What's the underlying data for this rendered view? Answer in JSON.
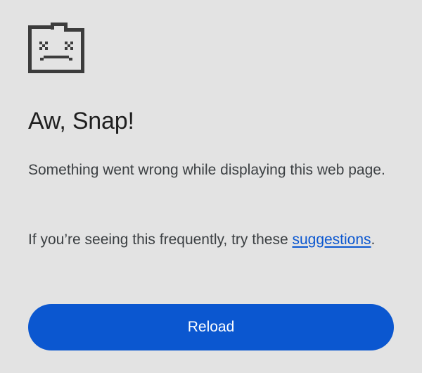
{
  "error": {
    "icon": "sad-tab-icon",
    "title": "Aw, Snap!",
    "description": "Something went wrong while displaying this web page.",
    "frequent_prefix": "If you’re seeing this frequently, try these ",
    "suggestions_link": "suggestions",
    "frequent_suffix": "."
  },
  "actions": {
    "reload_label": "Reload"
  },
  "colors": {
    "background": "#e3e3e3",
    "accent": "#0b57d0",
    "icon": "#3c3c3c"
  }
}
